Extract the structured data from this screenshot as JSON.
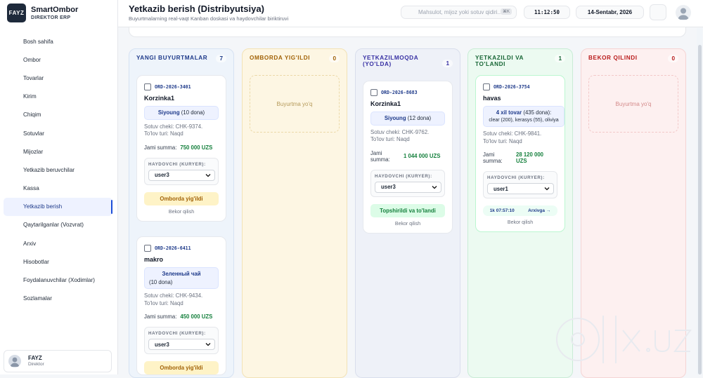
{
  "brand": {
    "logo": "FAYZ",
    "title": "SmartOmbor",
    "subtitle": "DIREKTOR ERP"
  },
  "sidebar": {
    "items": [
      {
        "label": "Bosh sahifa"
      },
      {
        "label": "Ombor"
      },
      {
        "label": "Tovarlar"
      },
      {
        "label": "Kirim"
      },
      {
        "label": "Chiqim"
      },
      {
        "label": "Sotuvlar"
      },
      {
        "label": "Mijozlar"
      },
      {
        "label": "Yetkazib beruvchilar"
      },
      {
        "label": "Kassa"
      },
      {
        "label": "Yetkazib berish",
        "active": true
      },
      {
        "label": "Qaytarilganlar (Vozvrat)"
      },
      {
        "label": "Arxiv"
      },
      {
        "label": "Hisobotlar"
      },
      {
        "label": "Foydalanuvchilar (Xodimlar)"
      },
      {
        "label": "Sozlamalar"
      }
    ]
  },
  "user": {
    "name": "FAYZ",
    "role": "Direktor"
  },
  "header": {
    "title": "Yetkazib berish (Distribyutsiya)",
    "subtitle": "Buyurtmalarning real-vaqt Kanban doskasi va haydovchilar biriktiruvi",
    "search_placeholder": "Mahsulot, mijoz yoki sotuv qidiri...",
    "search_shortcut": "⌘K",
    "clock": "11:12:50",
    "date": "14-Sentabr, 2026"
  },
  "common": {
    "courier_label": "HAYDOVCHI (KURYER):",
    "total_label": "Jami summa:",
    "cancel": "Bekor qilish",
    "empty": "Buyurtma yo'q"
  },
  "columns": [
    {
      "title": "Yangi buyurtmalar",
      "count": "7"
    },
    {
      "title": "Omborda yig'ildi",
      "count": "0"
    },
    {
      "title": "Yetkazilmoqda (yo'lda)",
      "count": "1"
    },
    {
      "title": "Yetkazildi va to'landi",
      "count": "1"
    },
    {
      "title": "Bekor qilindi",
      "count": "0"
    }
  ],
  "cards": {
    "c1": {
      "id": "ORD-2026-3401",
      "customer": "Korzinka1",
      "item": "Siyoung",
      "qty": "(10 dona)",
      "receipt": "Sotuv cheki: CHK-9374.",
      "pay": "To'lov turi: Naqd",
      "total": "750 000 UZS",
      "courier": "user3",
      "status": "Omborda yig'ildi"
    },
    "c2": {
      "id": "ORD-2026-6411",
      "customer": "makro",
      "item": "Зеленный чай",
      "qty": "(10 dona)",
      "receipt": "Sotuv cheki: CHK-9434.",
      "pay": "To'lov turi: Naqd",
      "total": "450 000 UZS",
      "courier": "user3",
      "status": "Omborda yig'ildi"
    },
    "c3": {
      "id": "ORD-2026-8683",
      "customer": "Korzinka1",
      "item": "Siyoung",
      "qty": "(12 dona)",
      "receipt": "Sotuv cheki: CHK-9762.",
      "pay": "To'lov turi: Naqd",
      "total": "1 044 000 UZS",
      "courier": "user3",
      "status": "Topshirildi va to'landi"
    },
    "c4": {
      "id": "ORD-2026-3754",
      "customer": "havas",
      "item": "4 xil tovar",
      "qty": "(435 dona):",
      "details": "clear (200), kerasys (55), oliviya",
      "receipt": "Sotuv cheki: CHK-9841.",
      "pay": "To'lov turi: Naqd",
      "total": "28 120 000 UZS",
      "courier": "user1",
      "timer": "1k 07:57:10",
      "archive": "Arxivga →"
    }
  }
}
